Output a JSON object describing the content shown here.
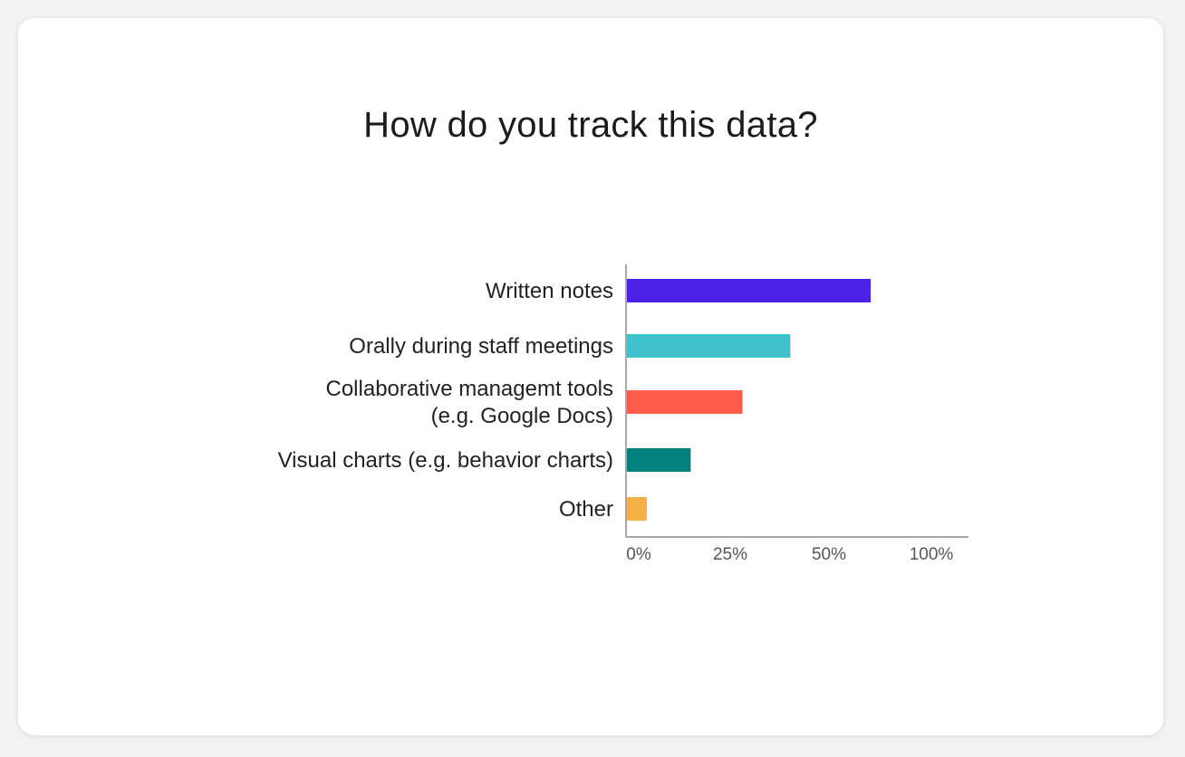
{
  "card": {
    "title": "How do you track this data?"
  },
  "chart_data": {
    "type": "bar",
    "orientation": "horizontal",
    "title": "How do you track this data?",
    "xlabel": "",
    "ylabel": "",
    "categories": [
      [
        "Written notes"
      ],
      [
        "Orally during staff meetings"
      ],
      [
        "Collaborative managemt tools",
        "(e.g. Google Docs)"
      ],
      [
        "Visual charts (e.g. behavior charts)"
      ],
      [
        "Other"
      ]
    ],
    "values": [
      71,
      41,
      29,
      16,
      5
    ],
    "colors": [
      "#4c21e8",
      "#3fc1c9",
      "#ff5a4a",
      "#05817f",
      "#f5b046"
    ],
    "xticks": [
      {
        "label": "0%",
        "value": 0
      },
      {
        "label": "25%",
        "value": 25
      },
      {
        "label": "50%",
        "value": 50
      },
      {
        "label": "100%",
        "value": 100
      }
    ],
    "xlim": [
      0,
      100
    ],
    "grid": false,
    "legend": "none"
  }
}
